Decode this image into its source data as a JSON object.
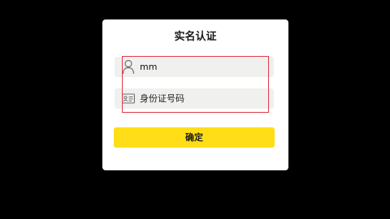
{
  "dialog": {
    "title": "实名认证",
    "name_field": {
      "icon": "person-icon",
      "value": "mm"
    },
    "id_field": {
      "icon": "id-card-icon",
      "placeholder": "身份证号码"
    },
    "confirm_label": "确定"
  },
  "colors": {
    "background": "#000000",
    "dialog": "#ffffff",
    "field": "#f0f1ef",
    "confirm": "#ffde17",
    "highlight_border": "#e03c4a"
  }
}
